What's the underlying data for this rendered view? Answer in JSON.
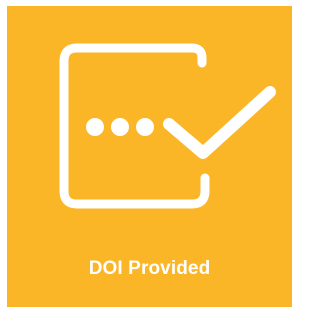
{
  "tile": {
    "label": "DOI Provided",
    "icon": "ellipsis-check-document-icon",
    "background_color": "#fbb627",
    "foreground_color": "#ffffff"
  }
}
